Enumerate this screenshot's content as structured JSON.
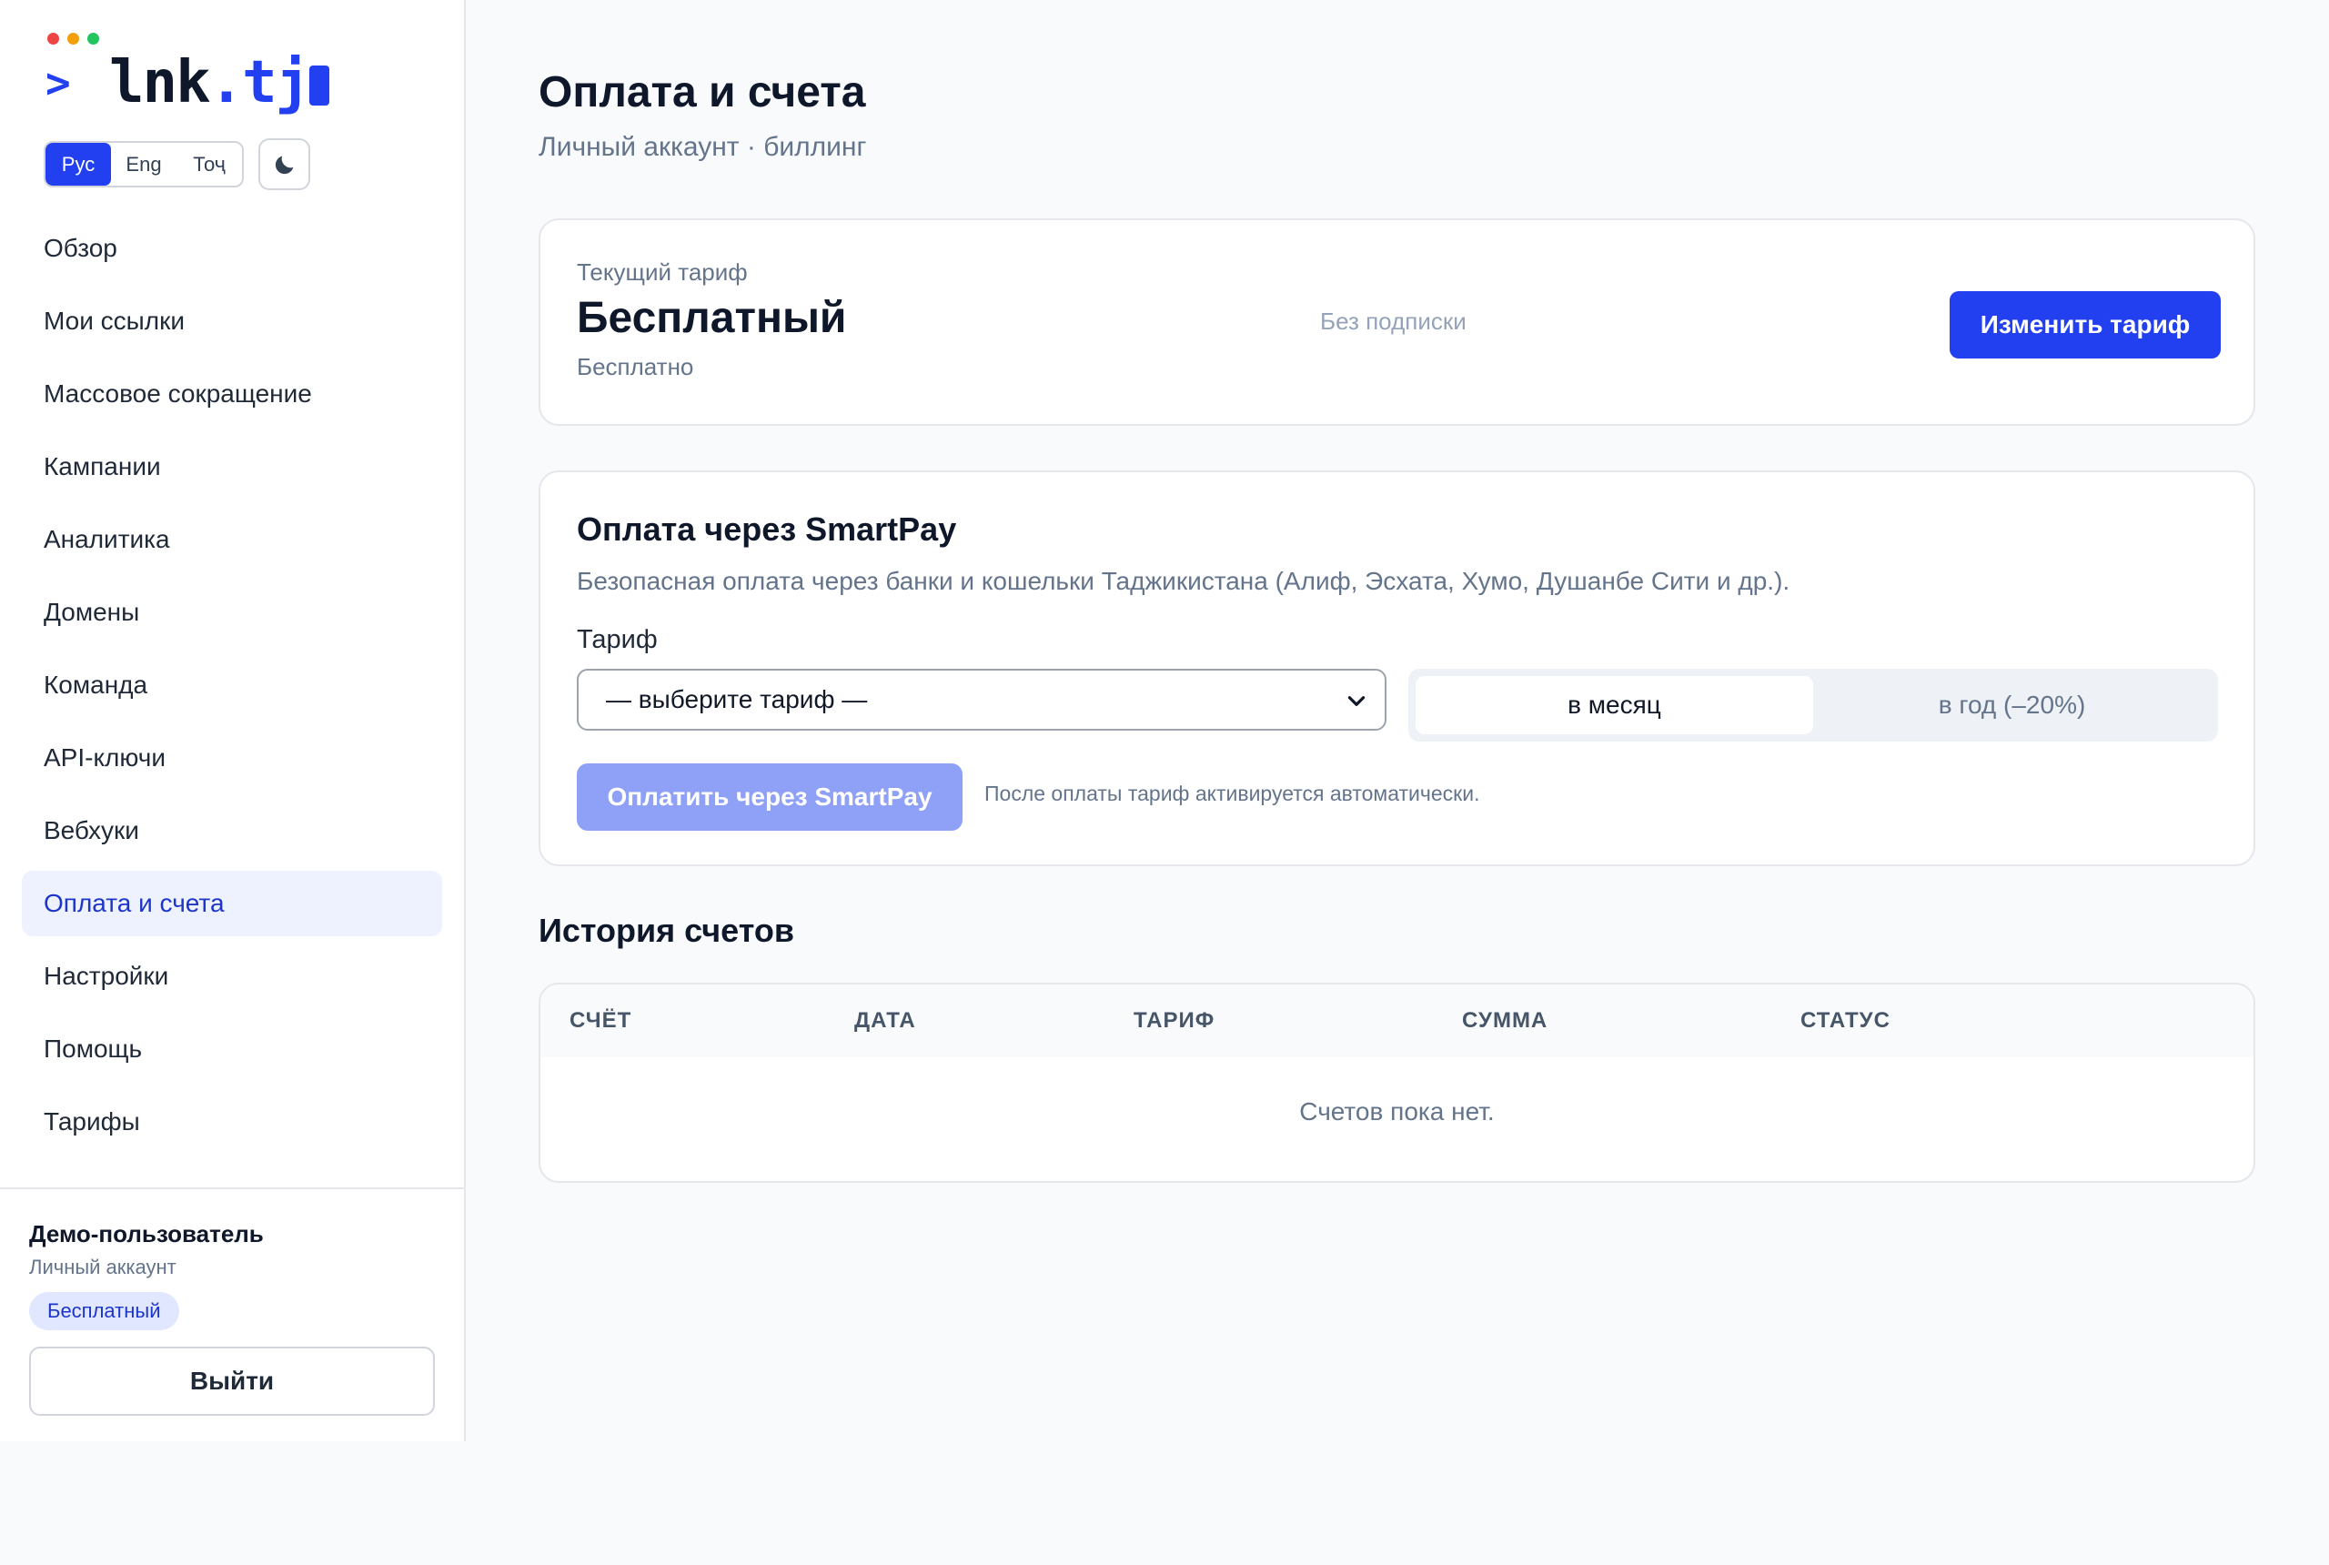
{
  "colors": {
    "accent": "#2340f0",
    "dot_red": "#ef4444",
    "dot_yellow": "#f59e0b",
    "dot_green": "#22c55e"
  },
  "logo": {
    "prompt": ">",
    "text": "lnk.tj"
  },
  "language": {
    "options": [
      "Рус",
      "Eng",
      "Тоҷ"
    ],
    "active": "Рус"
  },
  "theme_icon": "moon-icon",
  "nav": {
    "items": [
      {
        "label": "Обзор"
      },
      {
        "label": "Мои ссылки"
      },
      {
        "label": "Массовое сокращение"
      },
      {
        "label": "Кампании"
      },
      {
        "label": "Аналитика"
      },
      {
        "label": "Домены"
      },
      {
        "label": "Команда"
      },
      {
        "label": "API-ключи"
      },
      {
        "label": "Вебхуки"
      },
      {
        "label": "Оплата и счета"
      },
      {
        "label": "Настройки"
      },
      {
        "label": "Помощь"
      },
      {
        "label": "Тарифы"
      }
    ],
    "active": "Оплата и счета"
  },
  "user": {
    "name": "Демо-пользователь",
    "account_type": "Личный аккаунт",
    "plan_badge": "Бесплатный",
    "logout_label": "Выйти"
  },
  "page": {
    "title": "Оплата и счета",
    "subtitle": "Личный аккаунт · биллинг"
  },
  "current_plan": {
    "label": "Текущий тариф",
    "name": "Бесплатный",
    "price": "Бесплатно",
    "subscription": "Без подписки",
    "change_label": "Изменить тариф"
  },
  "smartpay": {
    "title": "Оплата через SmartPay",
    "description": "Безопасная оплата через банки и кошельки Таджикистана (Алиф, Эсхата, Хумо, Душанбе Сити и др.).",
    "field_label": "Тариф",
    "select_value": "— выберите тариф —",
    "period_monthly": "в месяц",
    "period_yearly": "в год (–20%)",
    "active_period": "monthly",
    "pay_label": "Оплатить через SmartPay",
    "note": "После оплаты тариф активируется автоматически."
  },
  "history": {
    "title": "История счетов",
    "columns": [
      "СЧЁТ",
      "ДАТА",
      "ТАРИФ",
      "СУММА",
      "СТАТУС"
    ],
    "rows": [],
    "empty_text": "Счетов пока нет."
  }
}
